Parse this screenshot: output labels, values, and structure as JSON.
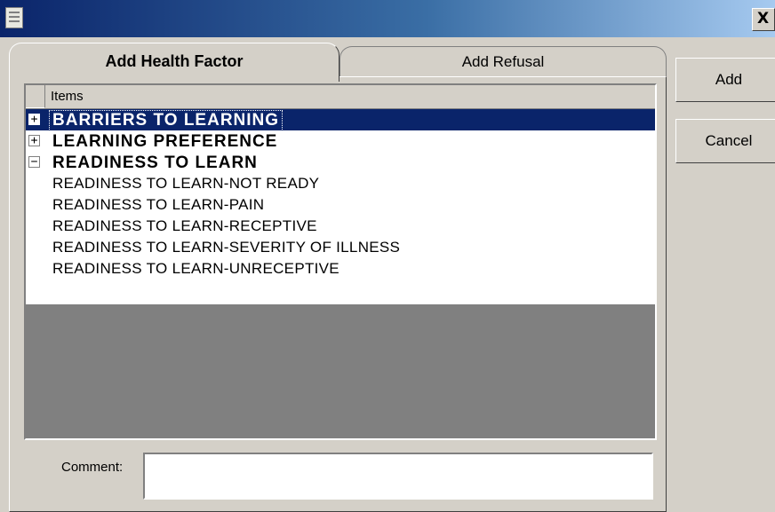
{
  "window": {
    "close_label": "X"
  },
  "tabs": [
    {
      "label": "Add Health Factor",
      "active": true
    },
    {
      "label": "Add Refusal",
      "active": false
    }
  ],
  "tree": {
    "header": "Items",
    "rows": [
      {
        "label": "BARRIERS TO LEARNING",
        "expander": "+",
        "selected": true
      },
      {
        "label": "LEARNING PREFERENCE",
        "expander": "+"
      },
      {
        "label": "READINESS TO LEARN",
        "expander": "−"
      },
      {
        "label": "READINESS TO LEARN-NOT READY"
      },
      {
        "label": "READINESS TO LEARN-PAIN"
      },
      {
        "label": "READINESS TO LEARN-RECEPTIVE"
      },
      {
        "label": "READINESS TO LEARN-SEVERITY OF ILLNESS"
      },
      {
        "label": "READINESS TO LEARN-UNRECEPTIVE"
      }
    ]
  },
  "comment": {
    "label": "Comment:",
    "value": ""
  },
  "buttons": {
    "add": "Add",
    "cancel": "Cancel"
  },
  "colors": {
    "selection": "#0a246a",
    "face": "#d4d0c8",
    "tree_empty": "#808080"
  }
}
